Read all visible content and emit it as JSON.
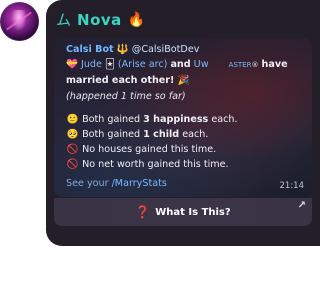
{
  "sender": {
    "glyph": "ム",
    "name": "Nova",
    "fire_icon": "fire-icon"
  },
  "message": {
    "bot_name": "Calsi Bot",
    "bot_symbol": "🔱",
    "bot_handle": "@CalsiBotDev",
    "line2": {
      "heart": "💝",
      "name1": "Jude",
      "tag": "(Arise arc)",
      "and": "and",
      "name2": "Uw",
      "name2_rest": "ASTER",
      "text": "have"
    },
    "line3": "married each other! 🎉",
    "note": "(happened 1 time so far)",
    "stats": [
      {
        "icon": "🙂",
        "prefix": "Both gained ",
        "bold": "3 happiness",
        "suffix": " each."
      },
      {
        "icon": "🥺",
        "prefix": "Both gained ",
        "bold": "1 child",
        "suffix": " each."
      },
      {
        "icon": "🚫",
        "prefix": "",
        "bold": "",
        "suffix": "No houses gained this time."
      },
      {
        "icon": "🚫",
        "prefix": "",
        "bold": "",
        "suffix": "No net worth gained this time."
      }
    ],
    "footer_prefix": "See your ",
    "footer_link": "/MarryStats",
    "time": "21:14"
  },
  "action_button": {
    "label": "What Is This?",
    "icon": "❓"
  },
  "colors": {
    "bubble": "#241e28",
    "accent": "#3ad5c4",
    "link": "#7db8ff",
    "fire": "#ff6a2a"
  }
}
